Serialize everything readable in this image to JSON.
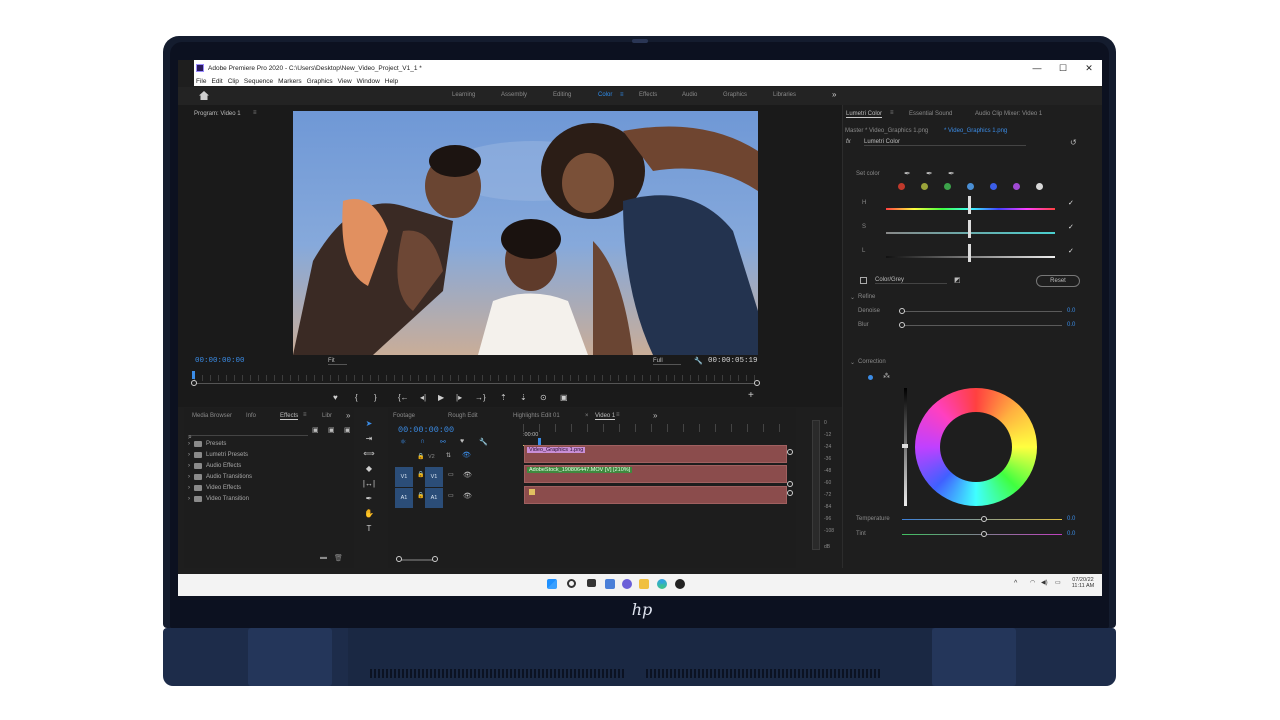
{
  "app": {
    "title": "Adobe Premiere Pro 2020 - C:\\Users\\Desktop\\New_Video_Project_V1_1 *",
    "menu": [
      "File",
      "Edit",
      "Clip",
      "Sequence",
      "Markers",
      "Graphics",
      "View",
      "Window",
      "Help"
    ],
    "window_controls": [
      "—",
      "☐",
      "✕"
    ]
  },
  "workspaces": {
    "home_icon": "home-icon",
    "tabs": [
      "Learning",
      "Assembly",
      "Editing",
      "Color",
      "Effects",
      "Audio",
      "Graphics",
      "Libraries"
    ],
    "active": "Color",
    "more": "»"
  },
  "program_monitor": {
    "title": "Program: Video 1",
    "menu_icon": "≡",
    "timecode_current": "00:00:00:00",
    "timecode_duration": "00:00:05:19",
    "fit_select": "Fit",
    "resolution_select": "Full",
    "add": "+"
  },
  "effects_panel": {
    "tabs": [
      "Media Browser",
      "Info",
      "Effects",
      "Libr"
    ],
    "active_tab": "Effects",
    "more": "»",
    "tree": [
      "Presets",
      "Lumetri Presets",
      "Audio Effects",
      "Audio Transitions",
      "Video Effects",
      "Video Transition"
    ]
  },
  "timeline": {
    "tabs": [
      "Footage",
      "Rough Edit",
      "Highlights Edit 01",
      "Video 1"
    ],
    "active_tab": "Video 1",
    "close": "×",
    "more": "»",
    "timecode": "00:00:00:00",
    "ruler_start": ":00:00",
    "tracks": [
      {
        "source": "",
        "target": "V2"
      },
      {
        "source": "V1",
        "target": "V1"
      },
      {
        "source": "A1",
        "target": "A1"
      }
    ],
    "clips": [
      {
        "label": "Video_Graphics 1.png"
      },
      {
        "label": "AdobeStock_190806447.MOV [V] [210%]"
      },
      {
        "label": ""
      }
    ]
  },
  "audio_meter": {
    "scale": [
      "0",
      "-12",
      "-24",
      "-36",
      "-48",
      "-60",
      "-72",
      "-84",
      "-96",
      "-108",
      "dB"
    ]
  },
  "lumetri": {
    "tabs": [
      "Lumetri Color",
      "Essential Sound",
      "Audio Clip Mixer: Video 1"
    ],
    "active_tab": "Lumetri Color",
    "menu_icon": "≡",
    "master": "Master * Video_Graphics 1.png",
    "clip": "* Video_Graphics 1.png",
    "fx": "fx",
    "effect": "Lumetri Color",
    "reset_icon": "reset-icon",
    "set_color": "Set color",
    "color_dots": [
      "#c0392b",
      "#9aa33a",
      "#3ca34a",
      "#4a8fd4",
      "#3b5ee8",
      "#a04ad4",
      "#d8d8d8"
    ],
    "hsl": [
      {
        "label": "H",
        "checked": "✓"
      },
      {
        "label": "S",
        "checked": "✓"
      },
      {
        "label": "L",
        "checked": "✓"
      }
    ],
    "color_grey": "Color/Grey",
    "reset_button": "Reset",
    "refine": {
      "title": "Refine",
      "denoise_label": "Denoise",
      "denoise_value": "0.0",
      "blur_label": "Blur",
      "blur_value": "0.0"
    },
    "correction": {
      "title": "Correction",
      "temperature_label": "Temperature",
      "temperature_value": "0.0",
      "tint_label": "Tint",
      "tint_value": "0.0"
    }
  },
  "taskbar": {
    "icons": [
      "start-icon",
      "search-icon",
      "taskview-icon",
      "widgets-icon",
      "chat-icon",
      "explorer-icon",
      "edge-icon",
      "media-icon"
    ],
    "date": "07/20/22",
    "time": "11:11 AM",
    "tray_arrow": "^"
  },
  "colors": {
    "accent": "#3b8ce6",
    "clip": "#8b4c4c",
    "track_target": "#2b4d78"
  }
}
